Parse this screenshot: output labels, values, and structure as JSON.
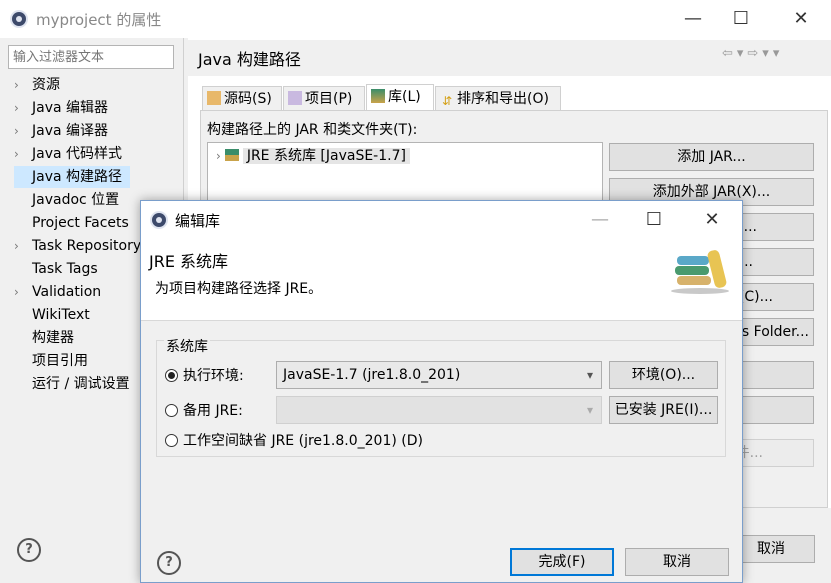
{
  "window": {
    "title": "myproject 的属性"
  },
  "filter": {
    "placeholder": "输入过滤器文本"
  },
  "tree": [
    {
      "label": "资源",
      "expandable": true
    },
    {
      "label": "Java 编辑器",
      "expandable": true
    },
    {
      "label": "Java 编译器",
      "expandable": true
    },
    {
      "label": "Java 代码样式",
      "expandable": true
    },
    {
      "label": "Java 构建路径",
      "expandable": false,
      "selected": true
    },
    {
      "label": "Javadoc 位置",
      "expandable": false
    },
    {
      "label": "Project Facets",
      "expandable": false
    },
    {
      "label": "Task Repository",
      "expandable": true
    },
    {
      "label": "Task Tags",
      "expandable": false
    },
    {
      "label": "Validation",
      "expandable": true
    },
    {
      "label": "WikiText",
      "expandable": false
    },
    {
      "label": "构建器",
      "expandable": false
    },
    {
      "label": "项目引用",
      "expandable": false
    },
    {
      "label": "运行 / 调试设置",
      "expandable": false
    }
  ],
  "page": {
    "title": "Java 构建路径",
    "tabs": [
      "源码(S)",
      "项目(P)",
      "库(L)",
      "排序和导出(O)"
    ],
    "jar_label": "构建路径上的 JAR 和类文件夹(T):",
    "jar_entry": "JRE 系统库 [JavaSE-1.7]",
    "buttons": [
      "添加 JAR...",
      "添加外部 JAR(X)...",
      "...)...",
      "...",
      "(C)...",
      "s Folder...",
      "",
      "",
      "件..."
    ],
    "cancel": "取消"
  },
  "dialog": {
    "title": "编辑库",
    "header_title": "JRE 系统库",
    "header_desc": "为项目构建路径选择 JRE。",
    "group_label": "系统库",
    "exec_env_label": "执行环境:",
    "exec_env_value": "JavaSE-1.7  (jre1.8.0_201)",
    "exec_env_button": "环境(O)...",
    "alt_jre_label": "备用 JRE:",
    "alt_jre_value": "",
    "alt_jre_button": "已安装 JRE(I)...",
    "workspace_label": "工作空间缺省 JRE  (jre1.8.0_201)  (D)",
    "finish": "完成(F)",
    "cancel": "取消"
  },
  "colors": {
    "selection": "#cde8ff",
    "accent": "#0078d7"
  },
  "icons": [
    "app-icon",
    "chevron-right-icon",
    "library-icon",
    "help-icon",
    "close-icon",
    "maximize-icon",
    "minimize-icon",
    "books-icon"
  ]
}
